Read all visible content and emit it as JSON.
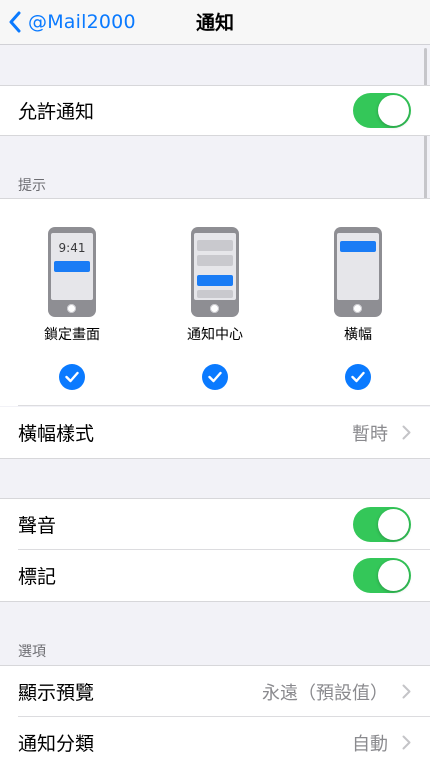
{
  "nav": {
    "back_label": "@Mail2000",
    "title": "通知"
  },
  "allow": {
    "label": "允許通知",
    "on": true
  },
  "alerts": {
    "header": "提示",
    "options": [
      {
        "label": "鎖定畫面",
        "checked": true,
        "time": "9:41"
      },
      {
        "label": "通知中心",
        "checked": true
      },
      {
        "label": "橫幅",
        "checked": true
      }
    ],
    "banner_style": {
      "label": "橫幅樣式",
      "value": "暫時"
    }
  },
  "sounds": {
    "label": "聲音",
    "on": true
  },
  "badges": {
    "label": "標記",
    "on": true
  },
  "options": {
    "header": "選項",
    "show_previews": {
      "label": "顯示預覽",
      "value": "永遠（預設值）"
    },
    "grouping": {
      "label": "通知分類",
      "value": "自動"
    }
  },
  "colors": {
    "accent": "#0a7aff",
    "toggle_on": "#34c759"
  }
}
